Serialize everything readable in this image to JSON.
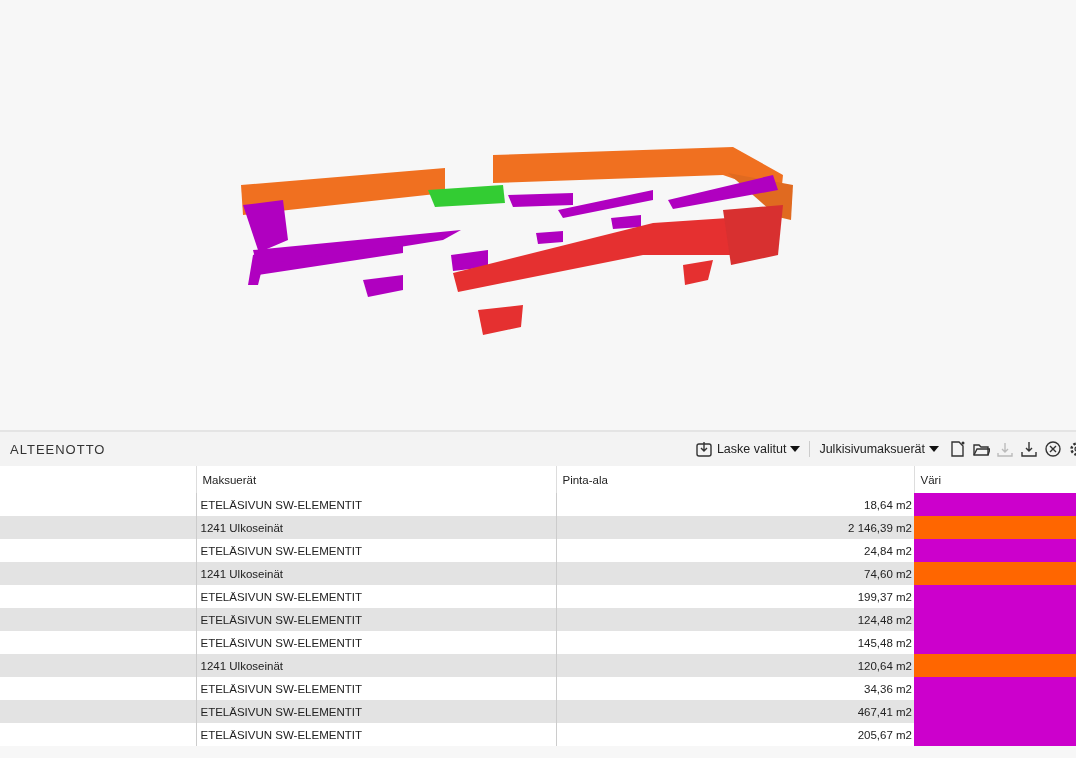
{
  "panel": {
    "title": "ALTEENOTTO"
  },
  "toolbar": [
    {
      "kind": "button",
      "label": "Laske valitut",
      "disabled": false
    },
    {
      "kind": "dropdown",
      "label": "Julkisivumaksuerät",
      "disabled": false
    },
    {
      "kind": "new",
      "disabled": false
    },
    {
      "kind": "open",
      "disabled": false
    },
    {
      "kind": "upload",
      "disabled": true
    },
    {
      "kind": "download",
      "disabled": false
    },
    {
      "kind": "clear",
      "disabled": false
    },
    {
      "kind": "settings",
      "disabled": false
    }
  ],
  "table": {
    "columns": [
      "Maksuerät",
      "Pinta-ala",
      "Väri"
    ],
    "rows": [
      {
        "name": "ETELÄSIVUN SW-ELEMENTIT",
        "area": "18,64 m2",
        "color": "#cc00cc"
      },
      {
        "name": "1241 Ulkoseinät",
        "area": "2 146,39 m2",
        "color": "#ff6600"
      },
      {
        "name": "ETELÄSIVUN SW-ELEMENTIT",
        "area": "24,84 m2",
        "color": "#cc00cc"
      },
      {
        "name": "1241 Ulkoseinät",
        "area": "74,60 m2",
        "color": "#ff6600"
      },
      {
        "name": "ETELÄSIVUN SW-ELEMENTIT",
        "area": "199,37 m2",
        "color": "#cc00cc"
      },
      {
        "name": "ETELÄSIVUN SW-ELEMENTIT",
        "area": "124,48 m2",
        "color": "#cc00cc"
      },
      {
        "name": "ETELÄSIVUN SW-ELEMENTIT",
        "area": "145,48 m2",
        "color": "#cc00cc"
      },
      {
        "name": "1241 Ulkoseinät",
        "area": "120,64 m2",
        "color": "#ff6600"
      },
      {
        "name": "ETELÄSIVUN SW-ELEMENTIT",
        "area": "34,36 m2",
        "color": "#cc00cc"
      },
      {
        "name": "ETELÄSIVUN SW-ELEMENTIT",
        "area": "467,41 m2",
        "color": "#cc00cc"
      },
      {
        "name": "ETELÄSIVUN SW-ELEMENTIT",
        "area": "205,67 m2",
        "color": "#cc00cc"
      }
    ]
  }
}
